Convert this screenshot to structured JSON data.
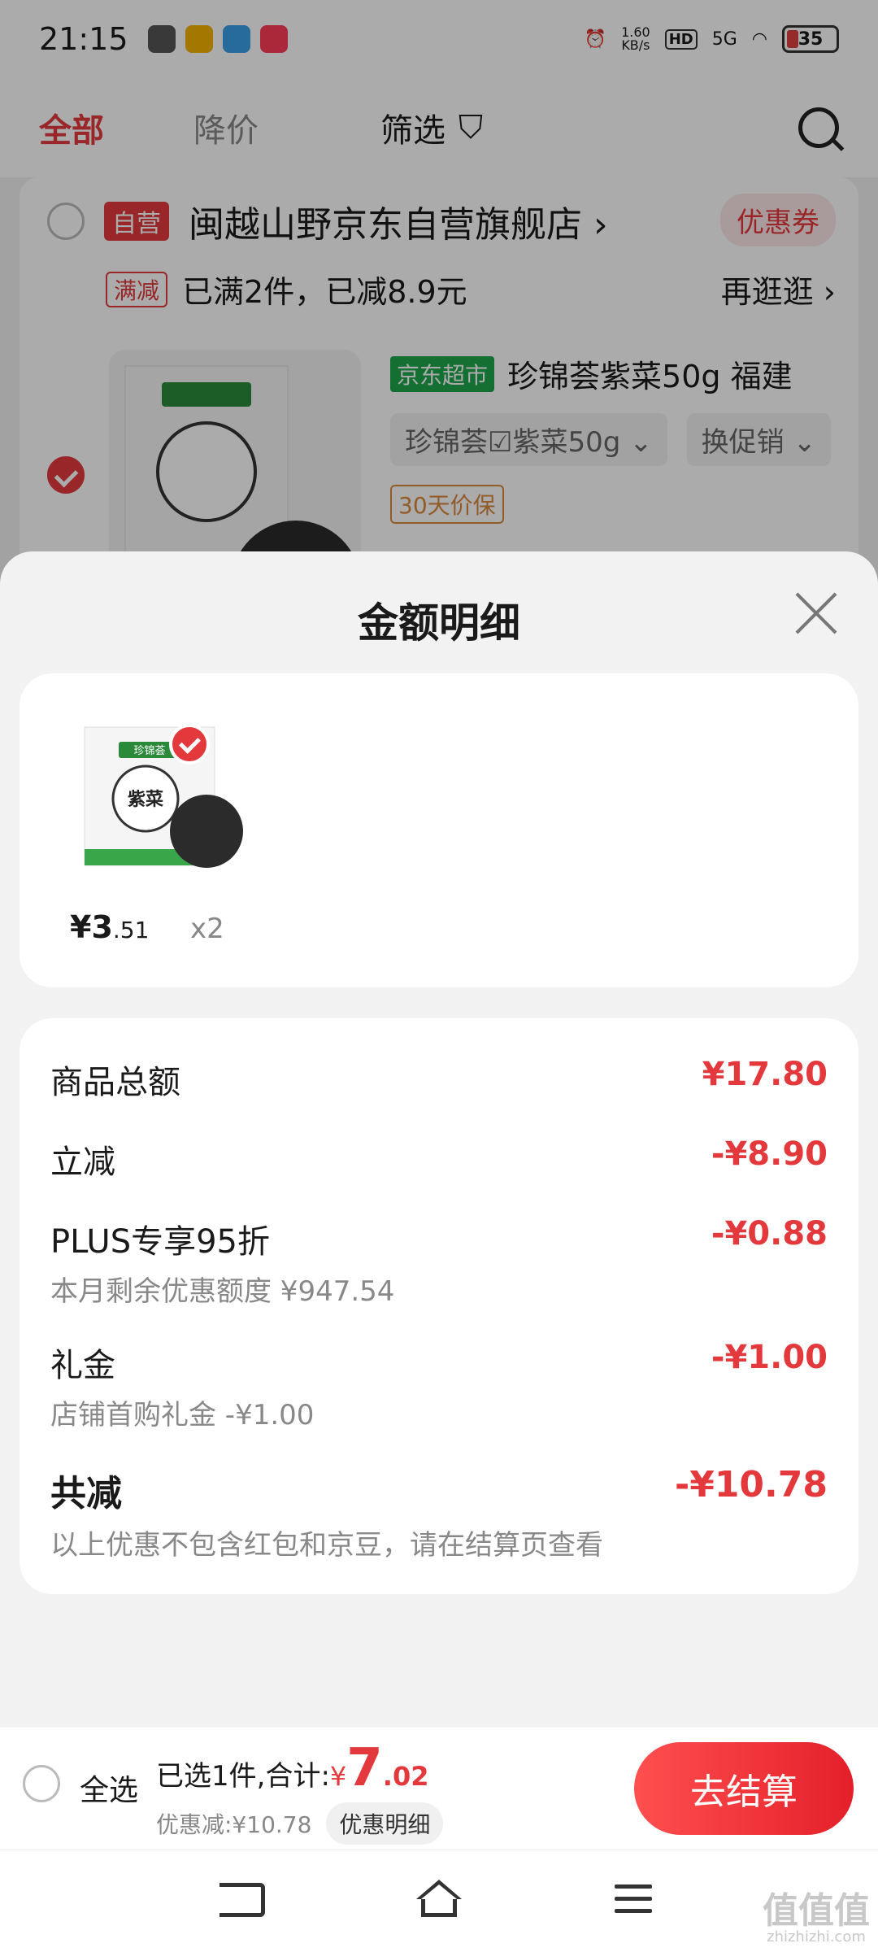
{
  "status": {
    "time": "21:15",
    "speed_value": "1.60",
    "speed_unit": "KB/s",
    "hd": "HD",
    "network": "5G",
    "battery": "35"
  },
  "nav": {
    "tab_all": "全部",
    "tab_price_drop": "降价",
    "filter": "筛选"
  },
  "shop": {
    "self_tag": "自营",
    "name": "闽越山野京东自营旗舰店 ›",
    "coupon": "优惠券",
    "promo_tag": "满减",
    "promo_text": "已满2件，已减8.9元",
    "promo_more": "再逛逛 ›"
  },
  "product": {
    "market_tag": "京东超市",
    "title": "珍锦荟紫菜50g 福建",
    "spec_chip": "珍锦荟☑紫菜50g ⌄",
    "promo_chip": "换促销 ⌄",
    "price_guard": "30天价保"
  },
  "sheet": {
    "title": "金额明细",
    "item": {
      "yen": "¥",
      "price_int": "3",
      "price_dec": ".51",
      "qty": "x2",
      "thumb_label": "紫菜",
      "thumb_brand": "珍锦荟"
    },
    "rows": {
      "goods_total_label": "商品总额",
      "goods_total_value": "¥17.80",
      "instant_label": "立减",
      "instant_value": "-¥8.90",
      "plus_label": "PLUS专享95折",
      "plus_sub": "本月剩余优惠额度 ¥947.54",
      "plus_value": "-¥0.88",
      "gift_label": "礼金",
      "gift_sub": "店铺首购礼金 -¥1.00",
      "gift_value": "-¥1.00",
      "total_label": "共减",
      "total_sub": "以上优惠不包含红包和京豆，请在结算页查看",
      "total_value": "-¥10.78"
    }
  },
  "bottombar": {
    "select_all": "全选",
    "summary_prefix": "已选1件,合计:",
    "yen": "¥",
    "total_int": "7",
    "total_dec": ".02",
    "discount": "优惠减:¥10.78",
    "detail_button": "优惠明细",
    "checkout": "去结算"
  },
  "watermark": {
    "main": "值值值",
    "site": "zhizhizhi.com"
  },
  "colors": {
    "accent": "#e4393c",
    "market_green": "#1fa64d"
  }
}
